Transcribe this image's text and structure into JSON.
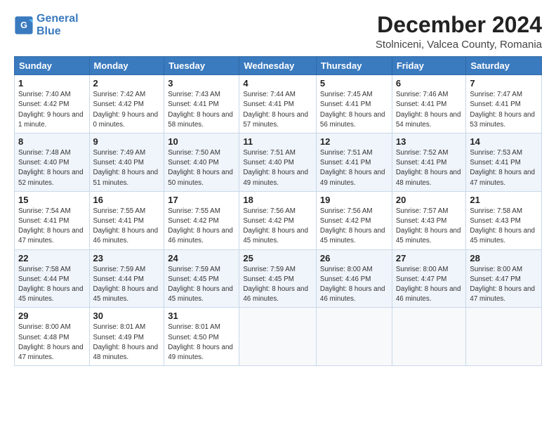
{
  "header": {
    "logo_line1": "General",
    "logo_line2": "Blue",
    "title": "December 2024",
    "subtitle": "Stolniceni, Valcea County, Romania"
  },
  "weekdays": [
    "Sunday",
    "Monday",
    "Tuesday",
    "Wednesday",
    "Thursday",
    "Friday",
    "Saturday"
  ],
  "weeks": [
    [
      {
        "day": "1",
        "sunrise": "Sunrise: 7:40 AM",
        "sunset": "Sunset: 4:42 PM",
        "daylight": "Daylight: 9 hours and 1 minute."
      },
      {
        "day": "2",
        "sunrise": "Sunrise: 7:42 AM",
        "sunset": "Sunset: 4:42 PM",
        "daylight": "Daylight: 9 hours and 0 minutes."
      },
      {
        "day": "3",
        "sunrise": "Sunrise: 7:43 AM",
        "sunset": "Sunset: 4:41 PM",
        "daylight": "Daylight: 8 hours and 58 minutes."
      },
      {
        "day": "4",
        "sunrise": "Sunrise: 7:44 AM",
        "sunset": "Sunset: 4:41 PM",
        "daylight": "Daylight: 8 hours and 57 minutes."
      },
      {
        "day": "5",
        "sunrise": "Sunrise: 7:45 AM",
        "sunset": "Sunset: 4:41 PM",
        "daylight": "Daylight: 8 hours and 56 minutes."
      },
      {
        "day": "6",
        "sunrise": "Sunrise: 7:46 AM",
        "sunset": "Sunset: 4:41 PM",
        "daylight": "Daylight: 8 hours and 54 minutes."
      },
      {
        "day": "7",
        "sunrise": "Sunrise: 7:47 AM",
        "sunset": "Sunset: 4:41 PM",
        "daylight": "Daylight: 8 hours and 53 minutes."
      }
    ],
    [
      {
        "day": "8",
        "sunrise": "Sunrise: 7:48 AM",
        "sunset": "Sunset: 4:40 PM",
        "daylight": "Daylight: 8 hours and 52 minutes."
      },
      {
        "day": "9",
        "sunrise": "Sunrise: 7:49 AM",
        "sunset": "Sunset: 4:40 PM",
        "daylight": "Daylight: 8 hours and 51 minutes."
      },
      {
        "day": "10",
        "sunrise": "Sunrise: 7:50 AM",
        "sunset": "Sunset: 4:40 PM",
        "daylight": "Daylight: 8 hours and 50 minutes."
      },
      {
        "day": "11",
        "sunrise": "Sunrise: 7:51 AM",
        "sunset": "Sunset: 4:40 PM",
        "daylight": "Daylight: 8 hours and 49 minutes."
      },
      {
        "day": "12",
        "sunrise": "Sunrise: 7:51 AM",
        "sunset": "Sunset: 4:41 PM",
        "daylight": "Daylight: 8 hours and 49 minutes."
      },
      {
        "day": "13",
        "sunrise": "Sunrise: 7:52 AM",
        "sunset": "Sunset: 4:41 PM",
        "daylight": "Daylight: 8 hours and 48 minutes."
      },
      {
        "day": "14",
        "sunrise": "Sunrise: 7:53 AM",
        "sunset": "Sunset: 4:41 PM",
        "daylight": "Daylight: 8 hours and 47 minutes."
      }
    ],
    [
      {
        "day": "15",
        "sunrise": "Sunrise: 7:54 AM",
        "sunset": "Sunset: 4:41 PM",
        "daylight": "Daylight: 8 hours and 47 minutes."
      },
      {
        "day": "16",
        "sunrise": "Sunrise: 7:55 AM",
        "sunset": "Sunset: 4:41 PM",
        "daylight": "Daylight: 8 hours and 46 minutes."
      },
      {
        "day": "17",
        "sunrise": "Sunrise: 7:55 AM",
        "sunset": "Sunset: 4:42 PM",
        "daylight": "Daylight: 8 hours and 46 minutes."
      },
      {
        "day": "18",
        "sunrise": "Sunrise: 7:56 AM",
        "sunset": "Sunset: 4:42 PM",
        "daylight": "Daylight: 8 hours and 45 minutes."
      },
      {
        "day": "19",
        "sunrise": "Sunrise: 7:56 AM",
        "sunset": "Sunset: 4:42 PM",
        "daylight": "Daylight: 8 hours and 45 minutes."
      },
      {
        "day": "20",
        "sunrise": "Sunrise: 7:57 AM",
        "sunset": "Sunset: 4:43 PM",
        "daylight": "Daylight: 8 hours and 45 minutes."
      },
      {
        "day": "21",
        "sunrise": "Sunrise: 7:58 AM",
        "sunset": "Sunset: 4:43 PM",
        "daylight": "Daylight: 8 hours and 45 minutes."
      }
    ],
    [
      {
        "day": "22",
        "sunrise": "Sunrise: 7:58 AM",
        "sunset": "Sunset: 4:44 PM",
        "daylight": "Daylight: 8 hours and 45 minutes."
      },
      {
        "day": "23",
        "sunrise": "Sunrise: 7:59 AM",
        "sunset": "Sunset: 4:44 PM",
        "daylight": "Daylight: 8 hours and 45 minutes."
      },
      {
        "day": "24",
        "sunrise": "Sunrise: 7:59 AM",
        "sunset": "Sunset: 4:45 PM",
        "daylight": "Daylight: 8 hours and 45 minutes."
      },
      {
        "day": "25",
        "sunrise": "Sunrise: 7:59 AM",
        "sunset": "Sunset: 4:45 PM",
        "daylight": "Daylight: 8 hours and 46 minutes."
      },
      {
        "day": "26",
        "sunrise": "Sunrise: 8:00 AM",
        "sunset": "Sunset: 4:46 PM",
        "daylight": "Daylight: 8 hours and 46 minutes."
      },
      {
        "day": "27",
        "sunrise": "Sunrise: 8:00 AM",
        "sunset": "Sunset: 4:47 PM",
        "daylight": "Daylight: 8 hours and 46 minutes."
      },
      {
        "day": "28",
        "sunrise": "Sunrise: 8:00 AM",
        "sunset": "Sunset: 4:47 PM",
        "daylight": "Daylight: 8 hours and 47 minutes."
      }
    ],
    [
      {
        "day": "29",
        "sunrise": "Sunrise: 8:00 AM",
        "sunset": "Sunset: 4:48 PM",
        "daylight": "Daylight: 8 hours and 47 minutes."
      },
      {
        "day": "30",
        "sunrise": "Sunrise: 8:01 AM",
        "sunset": "Sunset: 4:49 PM",
        "daylight": "Daylight: 8 hours and 48 minutes."
      },
      {
        "day": "31",
        "sunrise": "Sunrise: 8:01 AM",
        "sunset": "Sunset: 4:50 PM",
        "daylight": "Daylight: 8 hours and 49 minutes."
      },
      null,
      null,
      null,
      null
    ]
  ]
}
